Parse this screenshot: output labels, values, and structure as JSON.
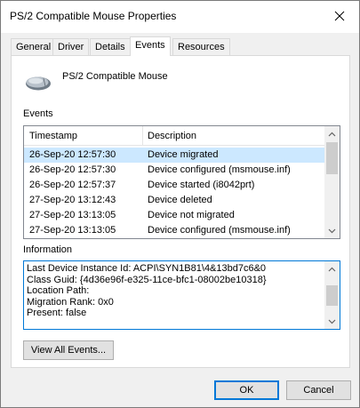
{
  "window": {
    "title": "PS/2 Compatible Mouse Properties"
  },
  "tabs": [
    {
      "label": "General"
    },
    {
      "label": "Driver"
    },
    {
      "label": "Details"
    },
    {
      "label": "Events",
      "active": true
    },
    {
      "label": "Resources"
    }
  ],
  "device": {
    "name": "PS/2 Compatible Mouse",
    "icon": "mouse-icon"
  },
  "events": {
    "label": "Events",
    "columns": [
      "Timestamp",
      "Description"
    ],
    "rows": [
      {
        "timestamp": "26-Sep-20 12:57:30",
        "description": "Device migrated",
        "selected": true
      },
      {
        "timestamp": "26-Sep-20 12:57:30",
        "description": "Device configured (msmouse.inf)"
      },
      {
        "timestamp": "26-Sep-20 12:57:37",
        "description": "Device started (i8042prt)"
      },
      {
        "timestamp": "27-Sep-20 13:12:43",
        "description": "Device deleted"
      },
      {
        "timestamp": "27-Sep-20 13:13:05",
        "description": "Device not migrated"
      },
      {
        "timestamp": "27-Sep-20 13:13:05",
        "description": "Device configured (msmouse.inf)"
      }
    ]
  },
  "information": {
    "label": "Information",
    "lines": [
      "Last Device Instance Id: ACPI\\SYN1B81\\4&13bd7c6&0",
      "Class Guid: {4d36e96f-e325-11ce-bfc1-08002be10318}",
      "Location Path:",
      "Migration Rank: 0x0",
      "Present: false"
    ]
  },
  "buttons": {
    "view_all_events": "View All Events...",
    "ok": "OK",
    "cancel": "Cancel"
  },
  "colors": {
    "selection": "#cce8ff",
    "focus_border": "#0078d7"
  }
}
